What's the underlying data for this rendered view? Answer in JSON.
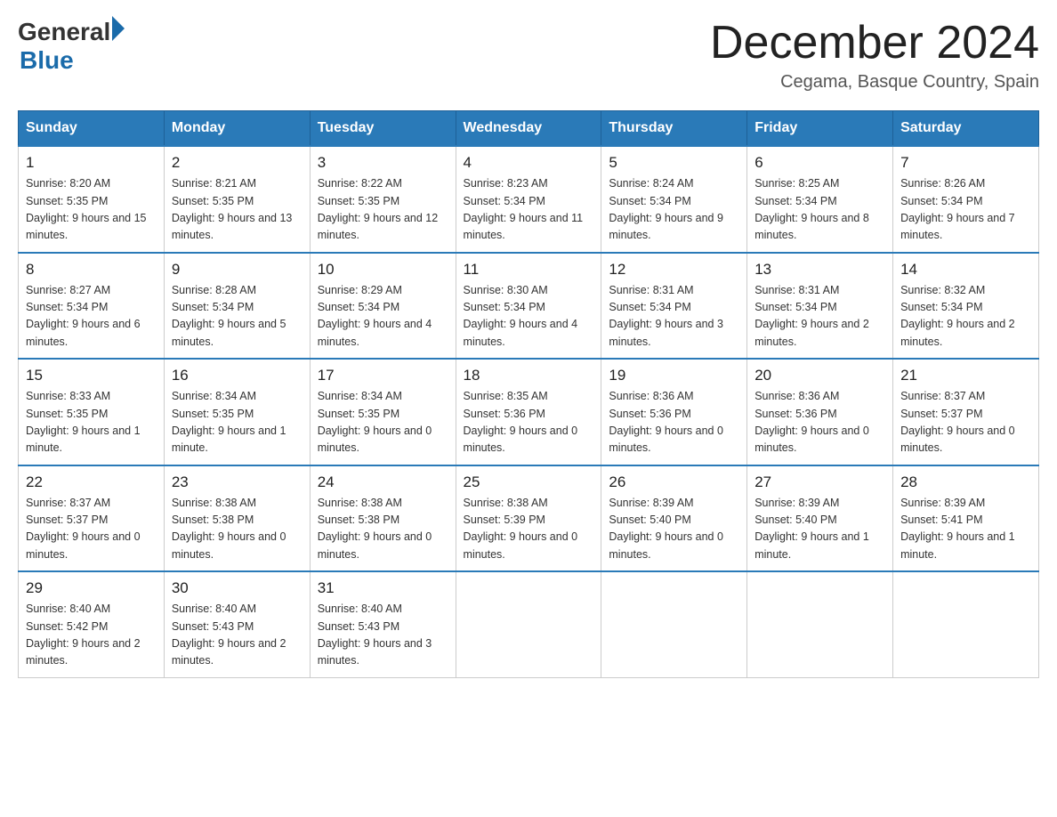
{
  "header": {
    "logo_general": "General",
    "logo_blue": "Blue",
    "month_title": "December 2024",
    "location": "Cegama, Basque Country, Spain"
  },
  "weekdays": [
    "Sunday",
    "Monday",
    "Tuesday",
    "Wednesday",
    "Thursday",
    "Friday",
    "Saturday"
  ],
  "weeks": [
    [
      {
        "day": "1",
        "sunrise": "8:20 AM",
        "sunset": "5:35 PM",
        "daylight": "9 hours and 15 minutes."
      },
      {
        "day": "2",
        "sunrise": "8:21 AM",
        "sunset": "5:35 PM",
        "daylight": "9 hours and 13 minutes."
      },
      {
        "day": "3",
        "sunrise": "8:22 AM",
        "sunset": "5:35 PM",
        "daylight": "9 hours and 12 minutes."
      },
      {
        "day": "4",
        "sunrise": "8:23 AM",
        "sunset": "5:34 PM",
        "daylight": "9 hours and 11 minutes."
      },
      {
        "day": "5",
        "sunrise": "8:24 AM",
        "sunset": "5:34 PM",
        "daylight": "9 hours and 9 minutes."
      },
      {
        "day": "6",
        "sunrise": "8:25 AM",
        "sunset": "5:34 PM",
        "daylight": "9 hours and 8 minutes."
      },
      {
        "day": "7",
        "sunrise": "8:26 AM",
        "sunset": "5:34 PM",
        "daylight": "9 hours and 7 minutes."
      }
    ],
    [
      {
        "day": "8",
        "sunrise": "8:27 AM",
        "sunset": "5:34 PM",
        "daylight": "9 hours and 6 minutes."
      },
      {
        "day": "9",
        "sunrise": "8:28 AM",
        "sunset": "5:34 PM",
        "daylight": "9 hours and 5 minutes."
      },
      {
        "day": "10",
        "sunrise": "8:29 AM",
        "sunset": "5:34 PM",
        "daylight": "9 hours and 4 minutes."
      },
      {
        "day": "11",
        "sunrise": "8:30 AM",
        "sunset": "5:34 PM",
        "daylight": "9 hours and 4 minutes."
      },
      {
        "day": "12",
        "sunrise": "8:31 AM",
        "sunset": "5:34 PM",
        "daylight": "9 hours and 3 minutes."
      },
      {
        "day": "13",
        "sunrise": "8:31 AM",
        "sunset": "5:34 PM",
        "daylight": "9 hours and 2 minutes."
      },
      {
        "day": "14",
        "sunrise": "8:32 AM",
        "sunset": "5:34 PM",
        "daylight": "9 hours and 2 minutes."
      }
    ],
    [
      {
        "day": "15",
        "sunrise": "8:33 AM",
        "sunset": "5:35 PM",
        "daylight": "9 hours and 1 minute."
      },
      {
        "day": "16",
        "sunrise": "8:34 AM",
        "sunset": "5:35 PM",
        "daylight": "9 hours and 1 minute."
      },
      {
        "day": "17",
        "sunrise": "8:34 AM",
        "sunset": "5:35 PM",
        "daylight": "9 hours and 0 minutes."
      },
      {
        "day": "18",
        "sunrise": "8:35 AM",
        "sunset": "5:36 PM",
        "daylight": "9 hours and 0 minutes."
      },
      {
        "day": "19",
        "sunrise": "8:36 AM",
        "sunset": "5:36 PM",
        "daylight": "9 hours and 0 minutes."
      },
      {
        "day": "20",
        "sunrise": "8:36 AM",
        "sunset": "5:36 PM",
        "daylight": "9 hours and 0 minutes."
      },
      {
        "day": "21",
        "sunrise": "8:37 AM",
        "sunset": "5:37 PM",
        "daylight": "9 hours and 0 minutes."
      }
    ],
    [
      {
        "day": "22",
        "sunrise": "8:37 AM",
        "sunset": "5:37 PM",
        "daylight": "9 hours and 0 minutes."
      },
      {
        "day": "23",
        "sunrise": "8:38 AM",
        "sunset": "5:38 PM",
        "daylight": "9 hours and 0 minutes."
      },
      {
        "day": "24",
        "sunrise": "8:38 AM",
        "sunset": "5:38 PM",
        "daylight": "9 hours and 0 minutes."
      },
      {
        "day": "25",
        "sunrise": "8:38 AM",
        "sunset": "5:39 PM",
        "daylight": "9 hours and 0 minutes."
      },
      {
        "day": "26",
        "sunrise": "8:39 AM",
        "sunset": "5:40 PM",
        "daylight": "9 hours and 0 minutes."
      },
      {
        "day": "27",
        "sunrise": "8:39 AM",
        "sunset": "5:40 PM",
        "daylight": "9 hours and 1 minute."
      },
      {
        "day": "28",
        "sunrise": "8:39 AM",
        "sunset": "5:41 PM",
        "daylight": "9 hours and 1 minute."
      }
    ],
    [
      {
        "day": "29",
        "sunrise": "8:40 AM",
        "sunset": "5:42 PM",
        "daylight": "9 hours and 2 minutes."
      },
      {
        "day": "30",
        "sunrise": "8:40 AM",
        "sunset": "5:43 PM",
        "daylight": "9 hours and 2 minutes."
      },
      {
        "day": "31",
        "sunrise": "8:40 AM",
        "sunset": "5:43 PM",
        "daylight": "9 hours and 3 minutes."
      },
      null,
      null,
      null,
      null
    ]
  ],
  "labels": {
    "sunrise": "Sunrise:",
    "sunset": "Sunset:",
    "daylight": "Daylight:"
  }
}
